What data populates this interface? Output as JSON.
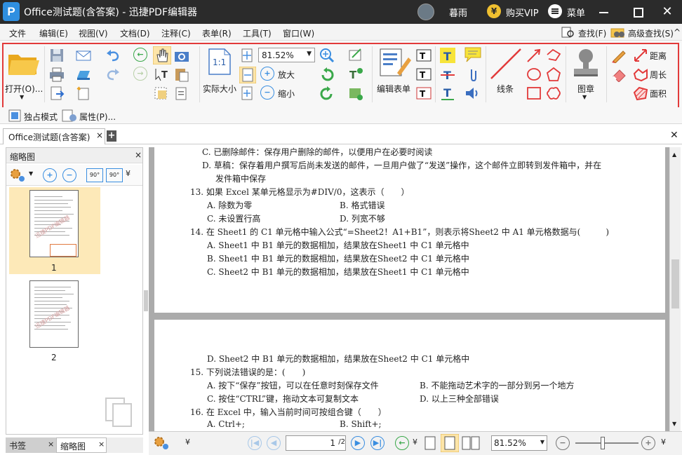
{
  "app": {
    "logo_letter": "P",
    "title": "Office测试题(含答案) - 迅捷PDF编辑器",
    "username": "暮雨",
    "vip_icon": "¥",
    "vip_label": "购买VIP",
    "menu_label": "菜单",
    "close_glyph": "✕"
  },
  "menu": {
    "items": [
      "文件",
      "编辑(E)",
      "视图(V)",
      "文档(D)",
      "注释(C)",
      "表单(R)",
      "工具(T)",
      "窗口(W)"
    ],
    "find": "查找(F)",
    "adv_find": "高级查找(S)",
    "collapse": "^"
  },
  "ribbon": {
    "open": "打开(O)...",
    "actual_size": "实际大小",
    "fit_label": "1:1",
    "zoom_value": "81.52%",
    "zoom_in": "放大",
    "zoom_out": "缩小",
    "edit_form": "编辑表单",
    "lines": "线条",
    "stamp": "图章",
    "distance": "距离",
    "perimeter": "周长",
    "area": "面积",
    "exclusive_mode": "独占模式",
    "properties": "属性(P)..."
  },
  "tabs": {
    "doc_tab": "Office测试题(含答案)",
    "close": "×",
    "add": "+",
    "closeall": "✕"
  },
  "thumbnails": {
    "title": "缩略图",
    "close": "×",
    "rotate_left": "90°",
    "rotate_right": "90°",
    "pages": [
      "1",
      "2"
    ],
    "watermark": "迅捷PDF编辑器",
    "bottom_tabs": [
      "书签",
      "缩略图"
    ]
  },
  "document": {
    "page1_lines": [
      "C. 已删除邮件：保存用户删除的邮件，以便用户在必要时阅读",
      "D. 草稿：保存着用户撰写后尚未发送的邮件，一旦用户做了“发送”操作，这个邮件立即转到发件箱中，并在",
      "发件箱中保存",
      "13. 如果 Excel 某单元格显示为#DIV/0，这表示（　　）",
      "A. 除数为零",
      "B. 格式错误",
      "C. 未设置行高",
      "D. 列宽不够",
      "14. 在 Sheet1 的 C1 单元格中输入公式“=Sheet2！A1+B1”，则表示将Sheet2 中 A1 单元格数据与(　　　)",
      "A. Sheet1 中 B1 单元的数据相加，结果放在Sheet1 中 C1 单元格中",
      "B. Sheet1 中 B1 单元的数据相加，结果放在Sheet2 中 C1 单元格中",
      "C. Sheet2 中 B1 单元的数据相加，结果放在Sheet1 中 C1 单元格中"
    ],
    "page2_lines": [
      "D. Sheet2 中 B1 单元的数据相加，结果放在Sheet2 中 C1 单元格中",
      "15. 下列说法错误的是：(　　)",
      "A. 按下“保存”按钮，可以在任意时刻保存文件",
      "B. 不能拖动艺术字的一部分到另一个地方",
      "C. 按住“CTRL”键，拖动文本可复制文本",
      "D. 以上三种全部错误",
      "16. 在 Excel 中，输入当前时间可按组合键（　　）",
      "A. Ctrl+;",
      "B. Shift+;"
    ]
  },
  "status": {
    "page_field": "1",
    "page_total": "/2",
    "zoom_value": "81.52%"
  },
  "colors": {
    "titlebar": "#2b2b2b",
    "accent_blue": "#3a8ee0",
    "highlight_red": "#e23a3a",
    "selected_thumb": "#fde9b8"
  }
}
